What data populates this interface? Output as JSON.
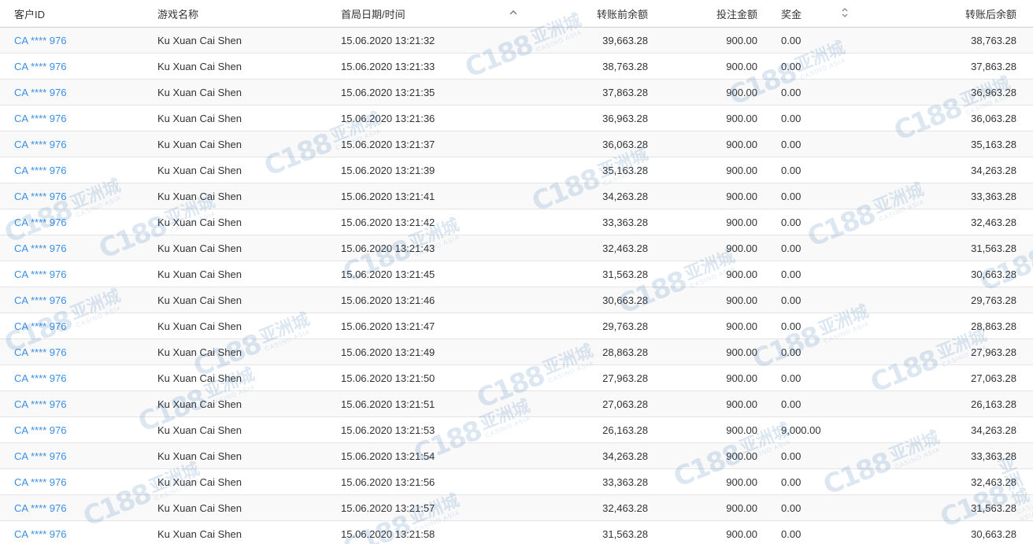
{
  "table": {
    "headers": {
      "customer_id": "客户ID",
      "game_name": "游戏名称",
      "first_round_datetime": "首局日期/时间",
      "balance_before": "转账前余额",
      "bet_amount": "投注金额",
      "prize": "奖金",
      "balance_after": "转账后余额"
    },
    "sort": {
      "active_column": "first_round_datetime",
      "active_direction_icon": "chevron-up-icon",
      "sortable_icon": "sort-both-icon"
    },
    "rows": [
      {
        "customer_id": "CA **** 976",
        "game_name": "Ku Xuan Cai Shen",
        "datetime": "15.06.2020 13:21:32",
        "balance_before": "39,663.28",
        "bet": "900.00",
        "prize": "0.00",
        "balance_after": "38,763.28"
      },
      {
        "customer_id": "CA **** 976",
        "game_name": "Ku Xuan Cai Shen",
        "datetime": "15.06.2020 13:21:33",
        "balance_before": "38,763.28",
        "bet": "900.00",
        "prize": "0.00",
        "balance_after": "37,863.28"
      },
      {
        "customer_id": "CA **** 976",
        "game_name": "Ku Xuan Cai Shen",
        "datetime": "15.06.2020 13:21:35",
        "balance_before": "37,863.28",
        "bet": "900.00",
        "prize": "0.00",
        "balance_after": "36,963.28"
      },
      {
        "customer_id": "CA **** 976",
        "game_name": "Ku Xuan Cai Shen",
        "datetime": "15.06.2020 13:21:36",
        "balance_before": "36,963.28",
        "bet": "900.00",
        "prize": "0.00",
        "balance_after": "36,063.28"
      },
      {
        "customer_id": "CA **** 976",
        "game_name": "Ku Xuan Cai Shen",
        "datetime": "15.06.2020 13:21:37",
        "balance_before": "36,063.28",
        "bet": "900.00",
        "prize": "0.00",
        "balance_after": "35,163.28"
      },
      {
        "customer_id": "CA **** 976",
        "game_name": "Ku Xuan Cai Shen",
        "datetime": "15.06.2020 13:21:39",
        "balance_before": "35,163.28",
        "bet": "900.00",
        "prize": "0.00",
        "balance_after": "34,263.28"
      },
      {
        "customer_id": "CA **** 976",
        "game_name": "Ku Xuan Cai Shen",
        "datetime": "15.06.2020 13:21:41",
        "balance_before": "34,263.28",
        "bet": "900.00",
        "prize": "0.00",
        "balance_after": "33,363.28"
      },
      {
        "customer_id": "CA **** 976",
        "game_name": "Ku Xuan Cai Shen",
        "datetime": "15.06.2020 13:21:42",
        "balance_before": "33,363.28",
        "bet": "900.00",
        "prize": "0.00",
        "balance_after": "32,463.28"
      },
      {
        "customer_id": "CA **** 976",
        "game_name": "Ku Xuan Cai Shen",
        "datetime": "15.06.2020 13:21:43",
        "balance_before": "32,463.28",
        "bet": "900.00",
        "prize": "0.00",
        "balance_after": "31,563.28"
      },
      {
        "customer_id": "CA **** 976",
        "game_name": "Ku Xuan Cai Shen",
        "datetime": "15.06.2020 13:21:45",
        "balance_before": "31,563.28",
        "bet": "900.00",
        "prize": "0.00",
        "balance_after": "30,663.28"
      },
      {
        "customer_id": "CA **** 976",
        "game_name": "Ku Xuan Cai Shen",
        "datetime": "15.06.2020 13:21:46",
        "balance_before": "30,663.28",
        "bet": "900.00",
        "prize": "0.00",
        "balance_after": "29,763.28"
      },
      {
        "customer_id": "CA **** 976",
        "game_name": "Ku Xuan Cai Shen",
        "datetime": "15.06.2020 13:21:47",
        "balance_before": "29,763.28",
        "bet": "900.00",
        "prize": "0.00",
        "balance_after": "28,863.28"
      },
      {
        "customer_id": "CA **** 976",
        "game_name": "Ku Xuan Cai Shen",
        "datetime": "15.06.2020 13:21:49",
        "balance_before": "28,863.28",
        "bet": "900.00",
        "prize": "0.00",
        "balance_after": "27,963.28"
      },
      {
        "customer_id": "CA **** 976",
        "game_name": "Ku Xuan Cai Shen",
        "datetime": "15.06.2020 13:21:50",
        "balance_before": "27,963.28",
        "bet": "900.00",
        "prize": "0.00",
        "balance_after": "27,063.28"
      },
      {
        "customer_id": "CA **** 976",
        "game_name": "Ku Xuan Cai Shen",
        "datetime": "15.06.2020 13:21:51",
        "balance_before": "27,063.28",
        "bet": "900.00",
        "prize": "0.00",
        "balance_after": "26,163.28"
      },
      {
        "customer_id": "CA **** 976",
        "game_name": "Ku Xuan Cai Shen",
        "datetime": "15.06.2020 13:21:53",
        "balance_before": "26,163.28",
        "bet": "900.00",
        "prize": "9,000.00",
        "balance_after": "34,263.28"
      },
      {
        "customer_id": "CA **** 976",
        "game_name": "Ku Xuan Cai Shen",
        "datetime": "15.06.2020 13:21:54",
        "balance_before": "34,263.28",
        "bet": "900.00",
        "prize": "0.00",
        "balance_after": "33,363.28"
      },
      {
        "customer_id": "CA **** 976",
        "game_name": "Ku Xuan Cai Shen",
        "datetime": "15.06.2020 13:21:56",
        "balance_before": "33,363.28",
        "bet": "900.00",
        "prize": "0.00",
        "balance_after": "32,463.28"
      },
      {
        "customer_id": "CA **** 976",
        "game_name": "Ku Xuan Cai Shen",
        "datetime": "15.06.2020 13:21:57",
        "balance_before": "32,463.28",
        "bet": "900.00",
        "prize": "0.00",
        "balance_after": "31,563.28"
      },
      {
        "customer_id": "CA **** 976",
        "game_name": "Ku Xuan Cai Shen",
        "datetime": "15.06.2020 13:21:58",
        "balance_before": "31,563.28",
        "bet": "900.00",
        "prize": "0.00",
        "balance_after": "30,663.28"
      }
    ]
  },
  "watermark": {
    "logo_text": "C188",
    "chinese_text": "亚洲城",
    "english_text": "CASINO ASIA"
  },
  "colors": {
    "link": "#3a8ee6",
    "watermark": "#2f6fb3",
    "row_stripe": "#f9f9f9",
    "row_border": "#e4e4e4"
  }
}
